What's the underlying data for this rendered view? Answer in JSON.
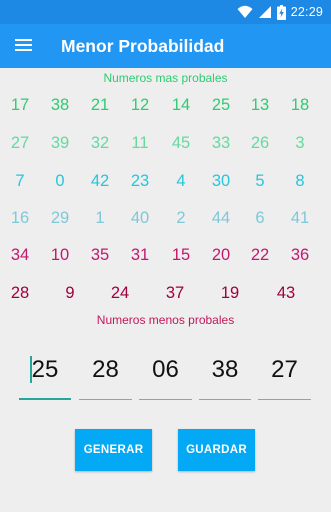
{
  "status_bar": {
    "time": "22:29",
    "icons": [
      "wifi-icon",
      "signal-icon",
      "battery-charging-icon"
    ]
  },
  "app_bar": {
    "menu_icon": "menu-icon",
    "title": "Menor Probabilidad"
  },
  "most_probable": {
    "label": "Numeros mas probales",
    "rows": [
      [
        "17",
        "38",
        "21",
        "12",
        "14",
        "25",
        "13",
        "18"
      ],
      [
        "27",
        "39",
        "32",
        "11",
        "45",
        "33",
        "26",
        "3"
      ],
      [
        "7",
        "0",
        "42",
        "23",
        "4",
        "30",
        "5",
        "8"
      ],
      [
        "16",
        "29",
        "1",
        "40",
        "2",
        "44",
        "6",
        "41"
      ],
      [
        "34",
        "10",
        "35",
        "31",
        "15",
        "20",
        "22",
        "36"
      ],
      [
        "28",
        "9",
        "24",
        "37",
        "19",
        "43"
      ]
    ]
  },
  "least_probable": {
    "label": "Numeros menos probales",
    "fields": [
      "25",
      "28",
      "06",
      "38",
      "27"
    ]
  },
  "buttons": {
    "generate": "GENERAR",
    "save": "GUARDAR"
  },
  "colors": {
    "status_bar": "#1e88e5",
    "app_bar": "#2196f3",
    "label_green": "#2ecc71",
    "label_pink": "#c2185b",
    "row_colors": [
      "#2ecc71",
      "#66d9a0",
      "#26c6da",
      "#7ec8d8",
      "#c2186e",
      "#a0003e"
    ],
    "button": "#03a9f4",
    "accent": "#26a69a"
  }
}
